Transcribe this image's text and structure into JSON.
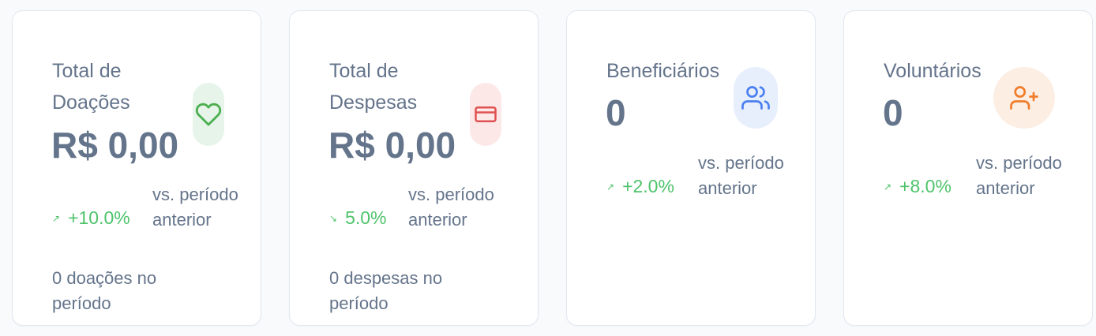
{
  "cards": [
    {
      "title": "Total de Doações",
      "value": "R$ 0,00",
      "icon": "heart-icon",
      "icon_color": "#4caf50",
      "icon_bg": "#e6f4ea",
      "trend_direction": "up",
      "trend_arrow": "↗",
      "trend_value": "+10.0%",
      "trend_color": "#4ec36b",
      "comparison": "vs. período anterior",
      "subtitle": "0 doações no período"
    },
    {
      "title": "Total de Despesas",
      "value": "R$ 0,00",
      "icon": "credit-card-icon",
      "icon_color": "#e05252",
      "icon_bg": "#fde8e8",
      "trend_direction": "down",
      "trend_arrow": "↘",
      "trend_value": "5.0%",
      "trend_color": "#4ec36b",
      "comparison": "vs. período anterior",
      "subtitle": "0 despesas no período"
    },
    {
      "title": "Beneficiários",
      "value": "0",
      "icon": "users-icon",
      "icon_color": "#4a7ff0",
      "icon_bg": "#e8effc",
      "trend_direction": "up",
      "trend_arrow": "↗",
      "trend_value": "+2.0%",
      "trend_color": "#4ec36b",
      "comparison": "vs. período anterior"
    },
    {
      "title": "Voluntários",
      "value": "0",
      "icon": "user-plus-icon",
      "icon_color": "#ef7d2b",
      "icon_bg": "#fdeee4",
      "trend_direction": "up",
      "trend_arrow": "↗",
      "trend_value": "+8.0%",
      "trend_color": "#4ec36b",
      "comparison": "vs. período anterior"
    }
  ]
}
